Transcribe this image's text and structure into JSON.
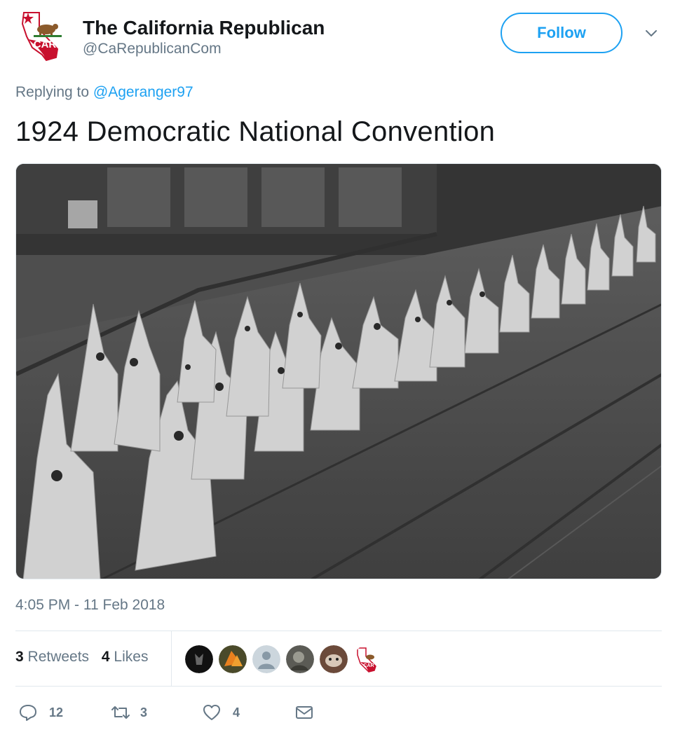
{
  "account": {
    "name": "The California Republican",
    "handle": "@CaRepublicanCom",
    "avatar_text": "CAR"
  },
  "header": {
    "follow_label": "Follow"
  },
  "reply": {
    "prefix": "Replying to ",
    "mention": "@Ageranger97"
  },
  "tweet": {
    "text": "1924 Democratic National Convention",
    "timestamp": "4:05 PM - 11 Feb 2018"
  },
  "stats": {
    "retweets_count": "3",
    "retweets_label": " Retweets",
    "likes_count": "4",
    "likes_label": " Likes"
  },
  "likers_avatar_text": "CAR",
  "actions": {
    "reply_count": "12",
    "retweet_count": "3",
    "like_count": "4"
  },
  "colors": {
    "accent": "#1da1f2",
    "muted": "#657786",
    "text": "#14171a",
    "border": "#e1e8ed"
  }
}
